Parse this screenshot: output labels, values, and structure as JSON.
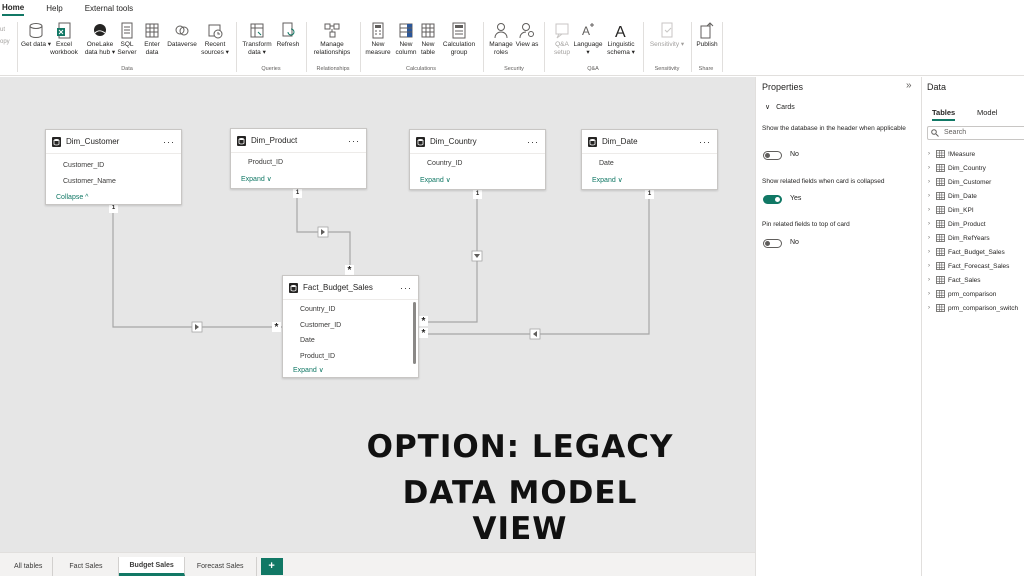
{
  "menubar": {
    "tabs": [
      "Home",
      "Help",
      "External tools"
    ]
  },
  "ribbon": {
    "clipboard": [
      "ut",
      "opy"
    ],
    "buttons": [
      {
        "label": "Get data ▾"
      },
      {
        "label": "Excel workbook"
      },
      {
        "label": "OneLake data hub ▾"
      },
      {
        "label": "SQL Server"
      },
      {
        "label": "Enter data"
      },
      {
        "label": "Dataverse"
      },
      {
        "label": "Recent sources ▾"
      },
      {
        "label": "Transform data ▾"
      },
      {
        "label": "Refresh"
      },
      {
        "label": "Manage relationships"
      },
      {
        "label": "New measure"
      },
      {
        "label": "New column"
      },
      {
        "label": "New table"
      },
      {
        "label": "Calculation group"
      },
      {
        "label": "Manage roles"
      },
      {
        "label": "View as"
      },
      {
        "label": "Q&A setup"
      },
      {
        "label": "Language ▾"
      },
      {
        "label": "Linguistic schema ▾"
      },
      {
        "label": "Sensitivity ▾"
      },
      {
        "label": "Publish"
      }
    ],
    "groups": [
      "Data",
      "Queries",
      "Relationships",
      "Calculations",
      "Security",
      "Q&A",
      "Sensitivity",
      "Share"
    ]
  },
  "cards": {
    "customer": {
      "title": "Dim_Customer",
      "fields": [
        "Customer_ID",
        "Customer_Name"
      ],
      "link": "Collapse ^"
    },
    "product": {
      "title": "Dim_Product",
      "fields": [
        "Product_ID"
      ],
      "link": "Expand ∨"
    },
    "country": {
      "title": "Dim_Country",
      "fields": [
        "Country_ID"
      ],
      "link": "Expand ∨"
    },
    "date": {
      "title": "Dim_Date",
      "fields": [
        "Date"
      ],
      "link": "Expand ∨"
    },
    "fact": {
      "title": "Fact_Budget_Sales",
      "fields": [
        "Country_ID",
        "Customer_ID",
        "Date",
        "Product_ID"
      ],
      "link": "Expand ∨"
    },
    "menu": "···"
  },
  "cardinality": {
    "one": "1",
    "many": "*"
  },
  "banner": {
    "line1": "OPTION: LEGACY",
    "line2": "DATA MODEL VIEW"
  },
  "tabs": [
    "All tables",
    "Fact Sales",
    "Budget Sales",
    "Forecast Sales"
  ],
  "active_tab": "Budget Sales",
  "tab_add": "+",
  "properties": {
    "title": "Properties",
    "collapse": "»",
    "section": "Cards",
    "items": [
      {
        "label": "Show the database in the header when applicable",
        "value": "No",
        "on": false
      },
      {
        "label": "Show related fields when card is collapsed",
        "value": "Yes",
        "on": true
      },
      {
        "label": "Pin related fields to top of card",
        "value": "No",
        "on": false
      }
    ]
  },
  "data_pane": {
    "title": "Data",
    "tabs": [
      "Tables",
      "Model"
    ],
    "search_placeholder": "Search",
    "tables": [
      "!Measure",
      "Dim_Country",
      "Dim_Customer",
      "Dim_Date",
      "Dim_KPI",
      "Dim_Product",
      "Dim_RefYears",
      "Fact_Budget_Sales",
      "Fact_Forecast_Sales",
      "Fact_Sales",
      "prm_comparison",
      "prm_comparison_switch"
    ]
  },
  "colors": {
    "accent": "#117865",
    "canvas": "#e6e6e6",
    "line": "#a6a6a6"
  }
}
